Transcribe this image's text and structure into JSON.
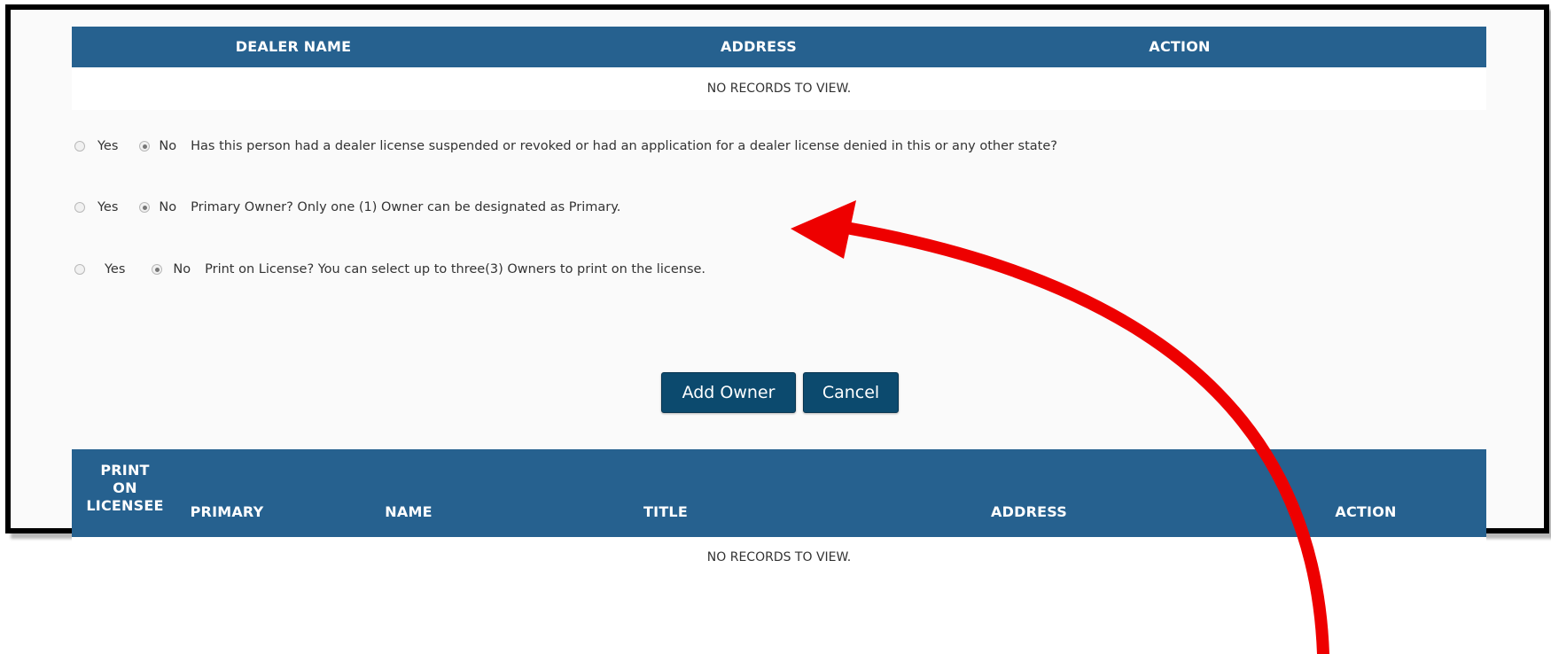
{
  "dealer_table": {
    "columns": [
      "DEALER NAME",
      "ADDRESS",
      "ACTION"
    ],
    "empty_text": "NO RECORDS TO VIEW."
  },
  "questions": [
    {
      "yes_label": "Yes",
      "no_label": "No",
      "selected": "No",
      "text": "Has this person had a dealer license suspended or revoked or had an application for a dealer license denied in this or any other state?"
    },
    {
      "yes_label": "Yes",
      "no_label": "No",
      "selected": "No",
      "text": "Primary Owner? Only one (1) Owner can be designated as Primary."
    },
    {
      "yes_label": "Yes",
      "no_label": "No",
      "selected": "No",
      "text": "Print on License? You can select up to three(3) Owners to print on the license."
    }
  ],
  "buttons": {
    "add_owner": "Add Owner",
    "cancel": "Cancel"
  },
  "owner_table": {
    "col_print_line1": "PRINT",
    "col_print_line2": "ON",
    "col_print_line3": "LICENSEE",
    "col_primary": "PRIMARY",
    "col_name": "NAME",
    "col_title": "TITLE",
    "col_address": "ADDRESS",
    "col_action": "ACTION",
    "empty_text": "NO RECORDS TO VIEW."
  },
  "colors": {
    "header_bg": "#26618f",
    "button_bg": "#0c4a6e",
    "annotation_arrow": "#ee0000"
  }
}
